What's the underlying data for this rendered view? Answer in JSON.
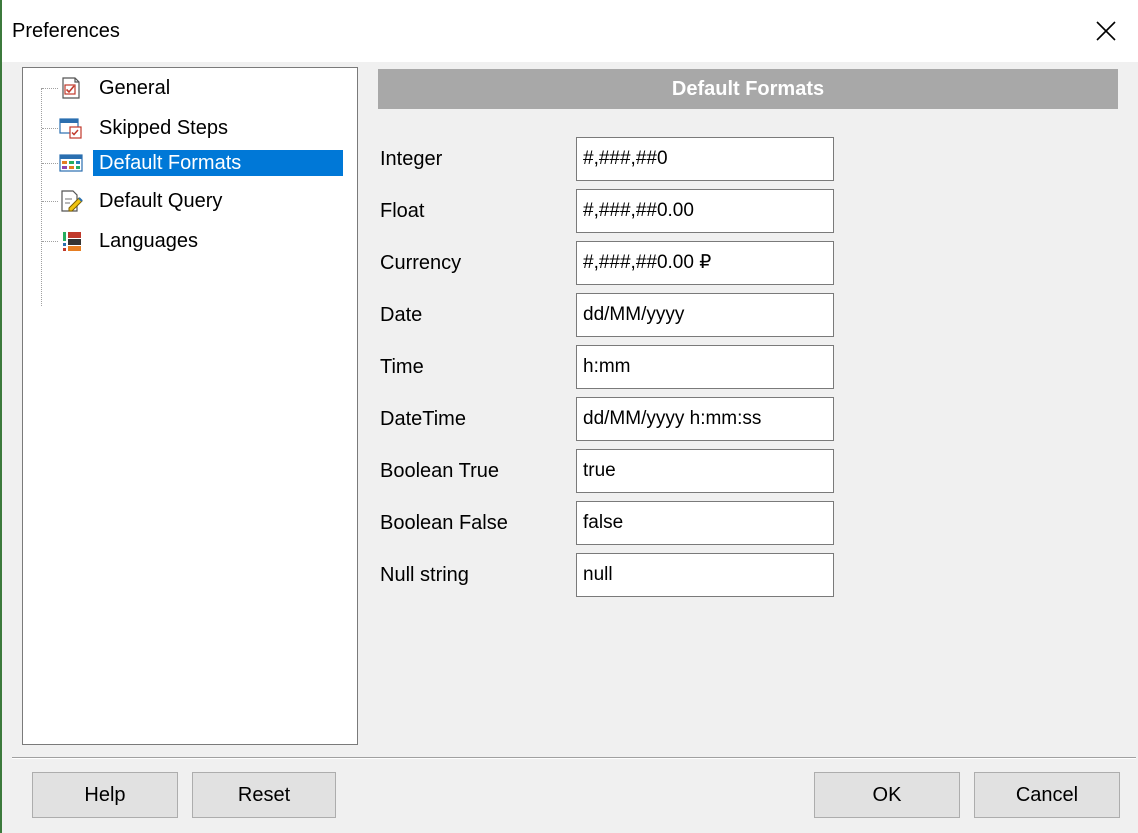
{
  "window": {
    "title": "Preferences"
  },
  "tree": {
    "items": [
      {
        "label": "General",
        "icon": "general-doc-icon"
      },
      {
        "label": "Skipped Steps",
        "icon": "skipped-steps-icon"
      },
      {
        "label": "Default Formats",
        "icon": "grid-table-icon",
        "selected": true
      },
      {
        "label": "Default Query",
        "icon": "query-edit-icon"
      },
      {
        "label": "Languages",
        "icon": "languages-flag-icon"
      }
    ]
  },
  "section": {
    "title": "Default Formats"
  },
  "fields": [
    {
      "label": "Integer",
      "value": "#,###,##0"
    },
    {
      "label": "Float",
      "value": "#,###,##0.00"
    },
    {
      "label": "Currency",
      "value": "#,###,##0.00 ₽"
    },
    {
      "label": "Date",
      "value": "dd/MM/yyyy"
    },
    {
      "label": "Time",
      "value": "h:mm"
    },
    {
      "label": "DateTime",
      "value": "dd/MM/yyyy h:mm:ss"
    },
    {
      "label": "Boolean True",
      "value": "true"
    },
    {
      "label": "Boolean False",
      "value": "false"
    },
    {
      "label": "Null string",
      "value": "null"
    }
  ],
  "buttons": {
    "help": "Help",
    "reset": "Reset",
    "ok": "OK",
    "cancel": "Cancel"
  },
  "colors": {
    "selection": "#0078d7",
    "header_bg": "#a8a8a8",
    "window_bg": "#f0f0f0"
  }
}
